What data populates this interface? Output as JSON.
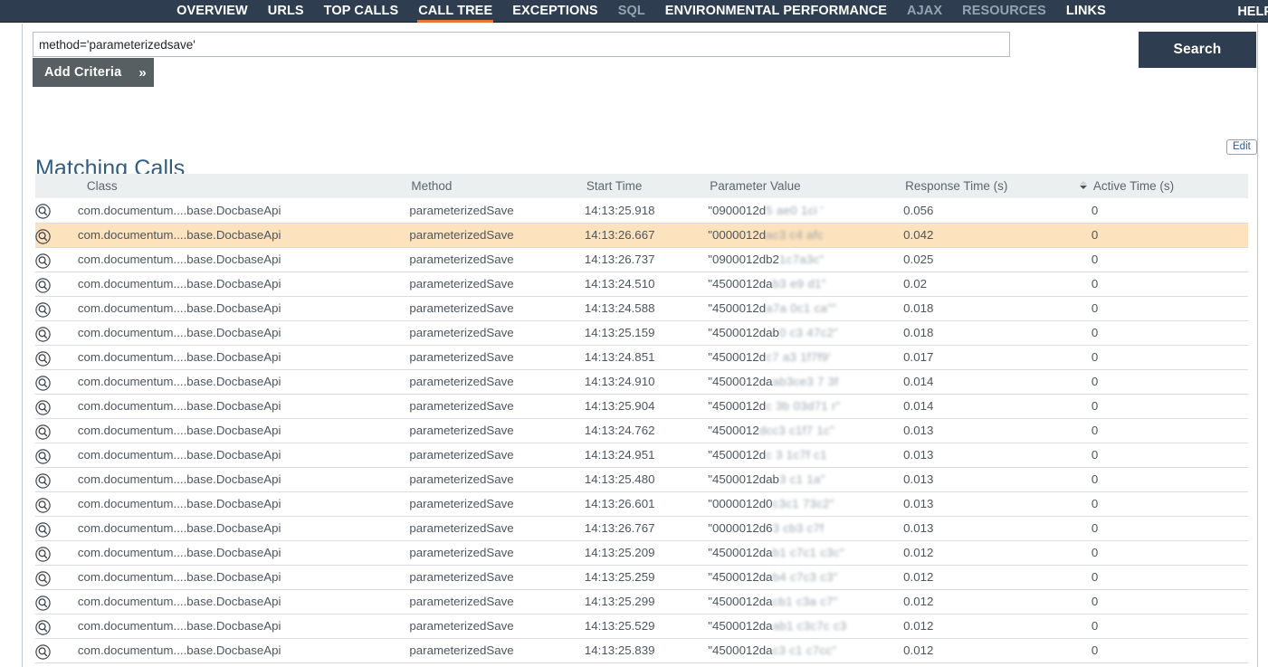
{
  "nav": {
    "items": [
      {
        "label": "OVERVIEW",
        "state": "normal"
      },
      {
        "label": "URLS",
        "state": "normal"
      },
      {
        "label": "TOP CALLS",
        "state": "normal"
      },
      {
        "label": "CALL TREE",
        "state": "active"
      },
      {
        "label": "EXCEPTIONS",
        "state": "normal"
      },
      {
        "label": "SQL",
        "state": "dim"
      },
      {
        "label": "ENVIRONMENTAL PERFORMANCE",
        "state": "normal"
      },
      {
        "label": "AJAX",
        "state": "dim"
      },
      {
        "label": "RESOURCES",
        "state": "dim"
      },
      {
        "label": "LINKS",
        "state": "normal"
      }
    ],
    "help_label": "HELP",
    "accent_color": "#e8762c",
    "background_color": "#2e3e50"
  },
  "search": {
    "query_value": "method='parameterizedsave'",
    "placeholder": "",
    "add_criteria_label": "Add Criteria",
    "add_criteria_chevron": "»",
    "search_button_label": "Search"
  },
  "section": {
    "title": "Matching Calls",
    "edit_label": "Edit"
  },
  "table": {
    "columns": [
      {
        "key": "icon",
        "label": ""
      },
      {
        "key": "class",
        "label": "Class"
      },
      {
        "key": "method",
        "label": "Method"
      },
      {
        "key": "start",
        "label": "Start Time"
      },
      {
        "key": "param",
        "label": "Parameter Value"
      },
      {
        "key": "resp",
        "label": "Response Time (s)"
      },
      {
        "key": "active",
        "label": "Active Time (s)"
      }
    ],
    "sorted_column": "Response Time (s)",
    "sort_direction": "desc",
    "row_icon": "magnifier-icon",
    "rows": [
      {
        "class": "com.documentum....base.DocbaseApi",
        "method": "parameterizedSave",
        "start": "14:13:25.918",
        "param_clear": "\"0900012d",
        "param_blur": "5 ae0 1ci '",
        "resp": "0.056",
        "active": "0",
        "highlighted": false
      },
      {
        "class": "com.documentum....base.DocbaseApi",
        "method": "parameterizedSave",
        "start": "14:13:26.667",
        "param_clear": "\"0000012d",
        "param_blur": "ac3 c4 afc",
        "resp": "0.042",
        "active": "0",
        "highlighted": true
      },
      {
        "class": "com.documentum....base.DocbaseApi",
        "method": "parameterizedSave",
        "start": "14:13:26.737",
        "param_clear": "\"0900012db2",
        "param_blur": "1c7a3c\"",
        "resp": "0.025",
        "active": "0",
        "highlighted": false
      },
      {
        "class": "com.documentum....base.DocbaseApi",
        "method": "parameterizedSave",
        "start": "14:13:24.510",
        "param_clear": "\"4500012da",
        "param_blur": "b3 e9 d1\"",
        "resp": "0.02",
        "active": "0",
        "highlighted": false
      },
      {
        "class": "com.documentum....base.DocbaseApi",
        "method": "parameterizedSave",
        "start": "14:13:24.588",
        "param_clear": "\"4500012d",
        "param_blur": "a7a 0c1 ca\"\"",
        "resp": "0.018",
        "active": "0",
        "highlighted": false
      },
      {
        "class": "com.documentum....base.DocbaseApi",
        "method": "parameterizedSave",
        "start": "14:13:25.159",
        "param_clear": "\"4500012dab",
        "param_blur": "0 c3 47c2\"",
        "resp": "0.018",
        "active": "0",
        "highlighted": false
      },
      {
        "class": "com.documentum....base.DocbaseApi",
        "method": "parameterizedSave",
        "start": "14:13:24.851",
        "param_clear": "\"4500012d",
        "param_blur": "c7 a3 1f7f9'",
        "resp": "0.017",
        "active": "0",
        "highlighted": false
      },
      {
        "class": "com.documentum....base.DocbaseApi",
        "method": "parameterizedSave",
        "start": "14:13:24.910",
        "param_clear": "\"4500012da",
        "param_blur": "ab3ce3 7 3f",
        "resp": "0.014",
        "active": "0",
        "highlighted": false
      },
      {
        "class": "com.documentum....base.DocbaseApi",
        "method": "parameterizedSave",
        "start": "14:13:25.904",
        "param_clear": "\"4500012d",
        "param_blur": "c 3b 03d71 r\"",
        "resp": "0.014",
        "active": "0",
        "highlighted": false
      },
      {
        "class": "com.documentum....base.DocbaseApi",
        "method": "parameterizedSave",
        "start": "14:13:24.762",
        "param_clear": "\"4500012",
        "param_blur": "dcc3 c1f7 1c\"",
        "resp": "0.013",
        "active": "0",
        "highlighted": false
      },
      {
        "class": "com.documentum....base.DocbaseApi",
        "method": "parameterizedSave",
        "start": "14:13:24.951",
        "param_clear": "\"4500012d",
        "param_blur": "c 3 1c7f c1",
        "resp": "0.013",
        "active": "0",
        "highlighted": false
      },
      {
        "class": "com.documentum....base.DocbaseApi",
        "method": "parameterizedSave",
        "start": "14:13:25.480",
        "param_clear": "\"4500012dab",
        "param_blur": "3 c1 1a\"",
        "resp": "0.013",
        "active": "0",
        "highlighted": false
      },
      {
        "class": "com.documentum....base.DocbaseApi",
        "method": "parameterizedSave",
        "start": "14:13:26.601",
        "param_clear": "\"0000012d0",
        "param_blur": "c3c1 73c2\"",
        "resp": "0.013",
        "active": "0",
        "highlighted": false
      },
      {
        "class": "com.documentum....base.DocbaseApi",
        "method": "parameterizedSave",
        "start": "14:13:26.767",
        "param_clear": "\"0000012d6",
        "param_blur": "3 cb3 c7f",
        "resp": "0.013",
        "active": "0",
        "highlighted": false
      },
      {
        "class": "com.documentum....base.DocbaseApi",
        "method": "parameterizedSave",
        "start": "14:13:25.209",
        "param_clear": "\"4500012da",
        "param_blur": "b1 c7c1 c3c\"",
        "resp": "0.012",
        "active": "0",
        "highlighted": false
      },
      {
        "class": "com.documentum....base.DocbaseApi",
        "method": "parameterizedSave",
        "start": "14:13:25.259",
        "param_clear": "\"4500012da",
        "param_blur": "b4 c7c3 c3\"",
        "resp": "0.012",
        "active": "0",
        "highlighted": false
      },
      {
        "class": "com.documentum....base.DocbaseApi",
        "method": "parameterizedSave",
        "start": "14:13:25.299",
        "param_clear": "\"4500012da",
        "param_blur": "cb1 c3a c7\"",
        "resp": "0.012",
        "active": "0",
        "highlighted": false
      },
      {
        "class": "com.documentum....base.DocbaseApi",
        "method": "parameterizedSave",
        "start": "14:13:25.529",
        "param_clear": "\"4500012da",
        "param_blur": "ab1 c3c7c c3",
        "resp": "0.012",
        "active": "0",
        "highlighted": false
      },
      {
        "class": "com.documentum....base.DocbaseApi",
        "method": "parameterizedSave",
        "start": "14:13:25.839",
        "param_clear": "\"4500012da",
        "param_blur": "c3 c1 c7cc\"",
        "resp": "0.012",
        "active": "0",
        "highlighted": false
      }
    ]
  }
}
